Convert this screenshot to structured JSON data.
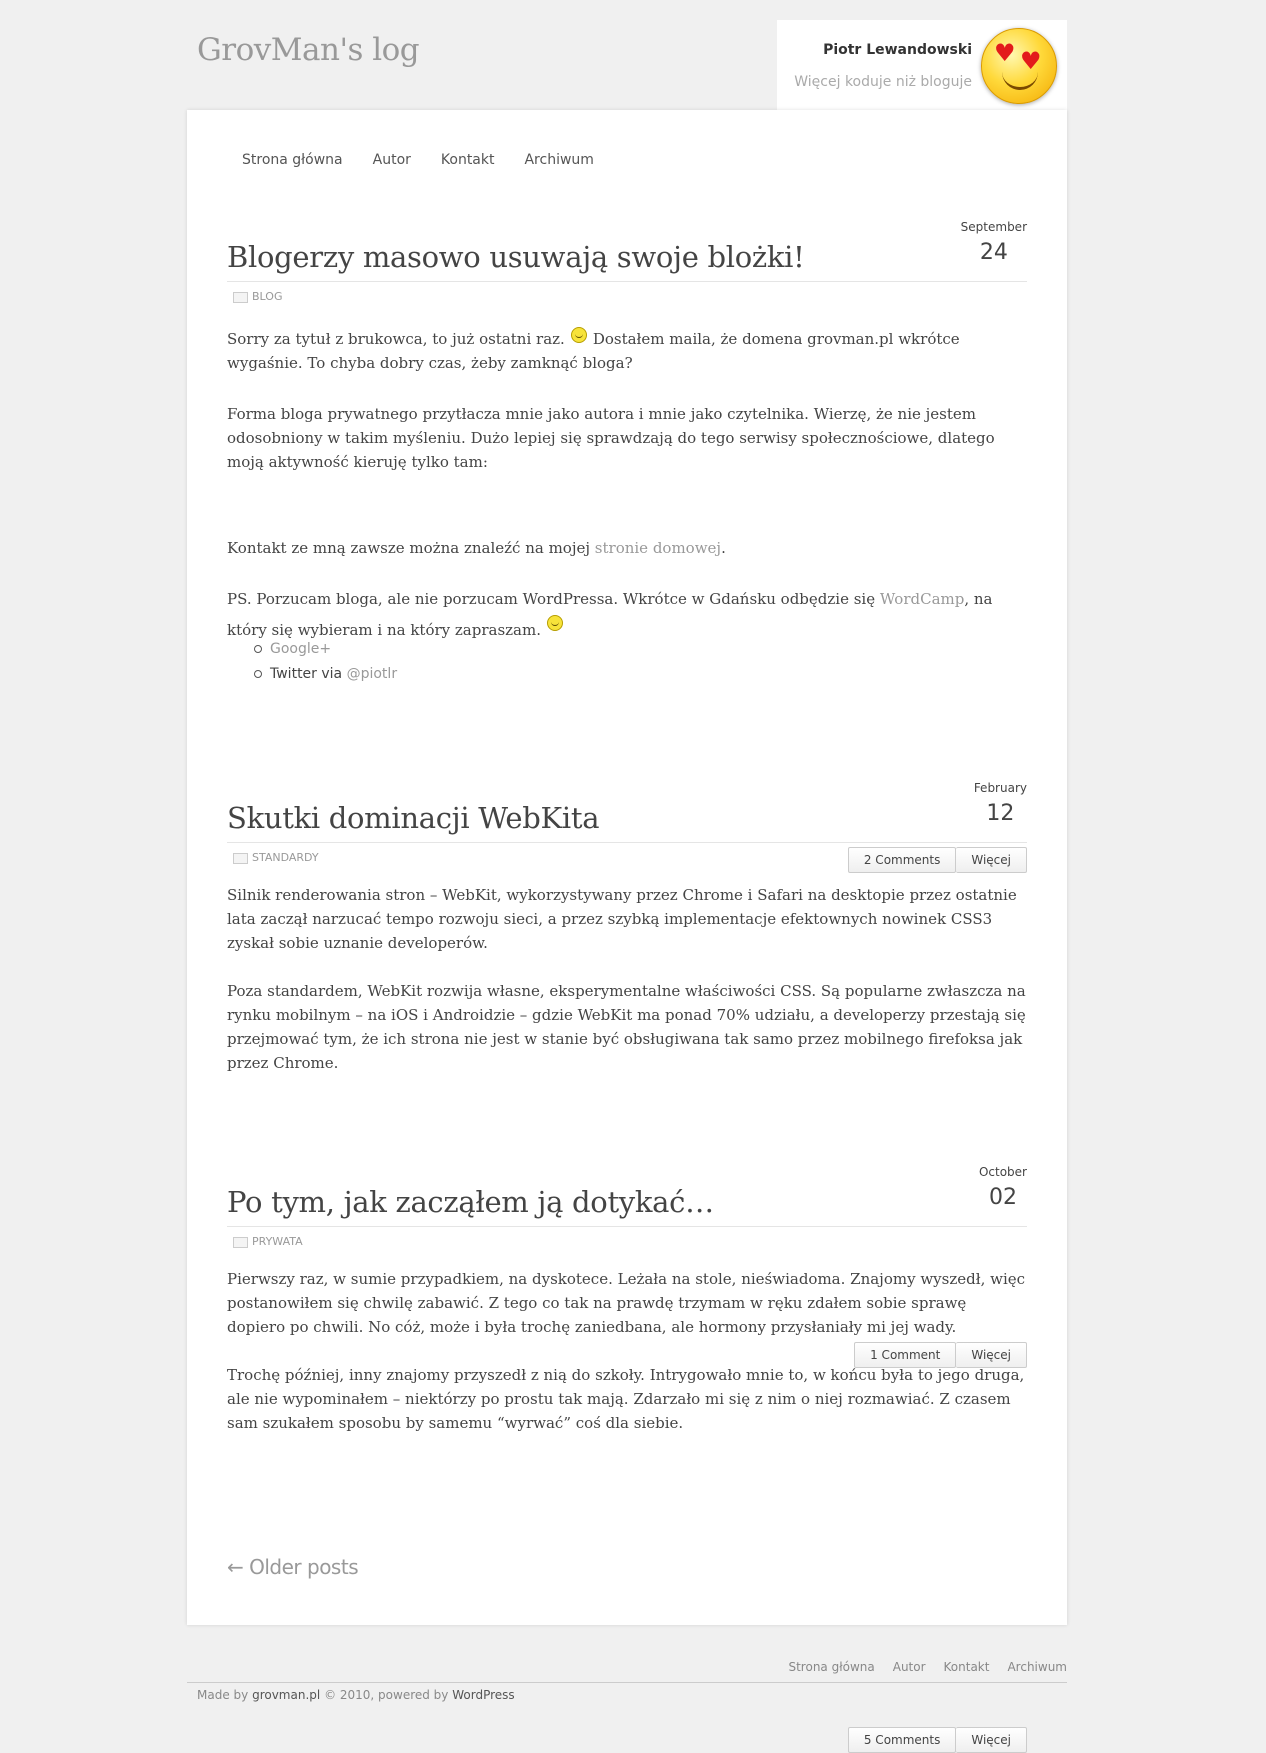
{
  "site": {
    "title": "GrovMan's log"
  },
  "author": {
    "name": "Piotr Lewandowski",
    "tagline": "Więcej koduje niż bloguje"
  },
  "nav": [
    "Strona główna",
    "Autor",
    "Kontakt",
    "Archiwum"
  ],
  "posts": [
    {
      "title": "Blogerzy masowo usuwają swoje blożki!",
      "month": "September",
      "day": "24",
      "category": "BLOG",
      "p1a": "Sorry za tytuł z brukowca, to już ostatni raz.",
      "p1b": "Dostałem maila, że domena grovman.pl wkrótce wygaśnie. To chyba dobry czas, żeby zamknąć bloga?",
      "p2": "Forma bloga prywatnego przytłacza mnie jako autora i mnie jako czytelnika. Wierzę, że nie jestem odosobniony w takim myśleniu. Dużo lepiej się sprawdzają do tego serwisy społecznościowe, dlatego moją aktywność kieruję tylko tam:",
      "list": [
        {
          "text": "Google+",
          "sub": ""
        },
        {
          "text": "Twitter via",
          "sub": "@piotlr"
        }
      ],
      "p3a": "Kontakt ze mną zawsze można znaleźć na mojej",
      "p3link": "stronie domowej",
      "p3b": ".",
      "p4a": "PS. Porzucam bloga, ale nie porzucam WordPressa. Wkrótce w Gdańsku odbędzie się",
      "p4link": "WordCamp",
      "p4b": ", na który się wybieram i na który zapraszam.",
      "comments": "2 Comments",
      "more": "Więcej"
    },
    {
      "title": "Skutki dominacji WebKita",
      "month": "February",
      "day": "12",
      "category": "STANDARDY",
      "p1": "Silnik renderowania stron – WebKit, wykorzystywany przez Chrome i Safari na desktopie przez ostatnie lata zaczął narzucać tempo rozwoju sieci, a przez szybką implementacje efektownych nowinek CSS3 zyskał sobie uznanie developerów.",
      "p2": "Poza standardem, WebKit rozwija własne, eksperymentalne właściwości CSS. Są popularne zwłaszcza na rynku mobilnym – na iOS i Androidzie – gdzie WebKit ma ponad 70% udziału, a developerzy przestają się przejmować tym, że ich strona nie jest w stanie być obsługiwana tak samo przez mobilnego firefoksa jak przez Chrome.",
      "comments": "1 Comment",
      "more": "Więcej"
    },
    {
      "title": "Po tym, jak zacząłem ją dotykać…",
      "month": "October",
      "day": "02",
      "category": "PRYWATA",
      "p1": "Pierwszy raz, w sumie przypadkiem, na dyskotece. Leżała na stole, nieświadoma. Znajomy wyszedł, więc postanowiłem się chwilę zabawić. Z tego co tak na prawdę trzymam w ręku zdałem sobie sprawę dopiero po chwili. No cóż, może i była trochę zaniedbana, ale hormony przysłaniały mi jej wady.",
      "p2": "Trochę później, inny znajomy przyszedł z nią do szkoły. Intrygowało mnie to, w końcu była to jego druga, ale nie wypominałem – niektórzy po prostu tak mają. Zdarzało mi się z nim o niej rozmawiać. Z czasem sam szukałem sposobu by samemu “wyrwać” coś dla siebie.",
      "comments": "5 Comments",
      "more": "Więcej"
    }
  ],
  "older": "← Older posts",
  "footer": {
    "nav": [
      "Strona główna",
      "Autor",
      "Kontakt",
      "Archiwum"
    ],
    "made_prefix": "Made by",
    "made_site": "grovman.pl",
    "made_mid": "© 2010, powered by",
    "made_wp": "WordPress"
  }
}
